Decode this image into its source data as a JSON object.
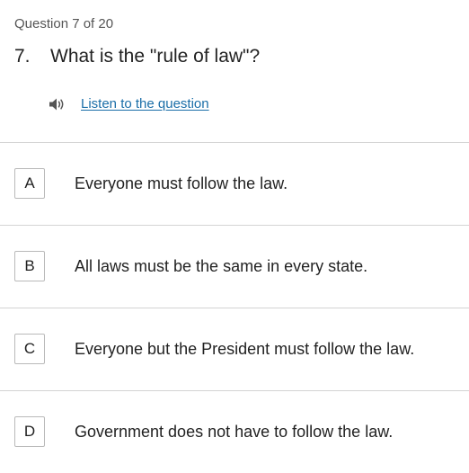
{
  "progress": "Question 7 of 20",
  "question": {
    "number": "7.",
    "text": "What is the \"rule of law\"?"
  },
  "listen": {
    "icon": "speaker-icon",
    "label": "Listen to the question"
  },
  "colors": {
    "link": "#1a6ea8",
    "divider": "#d4d4d4",
    "box_border": "#b9b9b9"
  },
  "options": [
    {
      "letter": "A",
      "text": "Everyone must follow the law."
    },
    {
      "letter": "B",
      "text": "All laws must be the same in every state."
    },
    {
      "letter": "C",
      "text": "Everyone but the President must follow the law."
    },
    {
      "letter": "D",
      "text": "Government does not have to follow the law."
    }
  ]
}
